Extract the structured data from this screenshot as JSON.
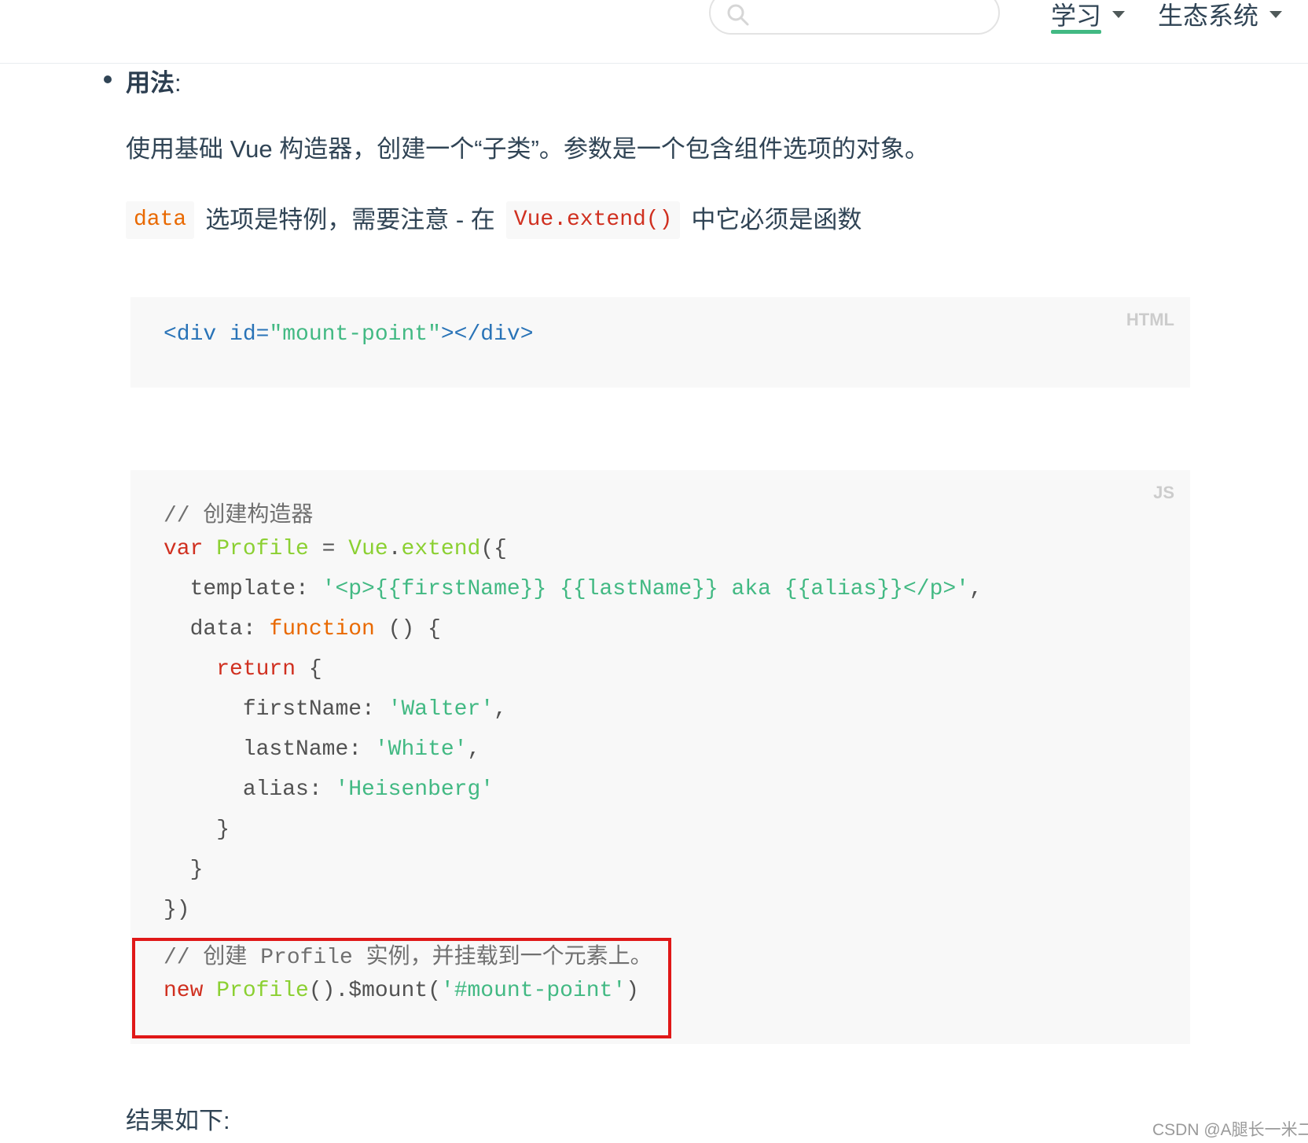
{
  "header": {
    "search_placeholder": "",
    "nav": [
      {
        "label": "学习"
      },
      {
        "label": "生态系统"
      }
    ]
  },
  "content": {
    "usage_label": "用法",
    "usage_colon": ":",
    "para1": "使用基础 Vue 构造器，创建一个“子类”。参数是一个包含组件选项的对象。",
    "para2": {
      "code1": "data",
      "text1": "选项是特例，需要注意 - 在",
      "code2": "Vue.extend()",
      "text2": "中它必须是函数"
    },
    "html_block": {
      "lang": "HTML",
      "line": {
        "open": "<div ",
        "attr": "id=",
        "value": "\"mount-point\"",
        "close": "></div>"
      }
    },
    "js_block": {
      "lang": "JS",
      "l1_comment": "// 创建构造器",
      "l2_var": "var",
      "l2_name": "Profile",
      "l2_eq": " = ",
      "l2_vue": "Vue",
      "l2_dot": ".",
      "l2_extend": "extend",
      "l2_tail": "({",
      "l3_key": "template: ",
      "l3_val": "'<p>{{firstName}} {{lastName}} aka {{alias}}</p>'",
      "l3_tail": ",",
      "l4_key": "data: ",
      "l4_fn": "function",
      "l4_tail": " () {",
      "l5_kw": "return",
      "l5_tail": " {",
      "l6_key": "firstName: ",
      "l6_val": "'Walter'",
      "l6_tail": ",",
      "l7_key": "lastName: ",
      "l7_val": "'White'",
      "l7_tail": ",",
      "l8_key": "alias: ",
      "l8_val": "'Heisenberg'",
      "l9": "}",
      "l10": "}",
      "l11": "})",
      "l12_comment": "// 创建 Profile 实例，并挂载到一个元素上。",
      "l13_new": "new",
      "l13_name": "Profile",
      "l13_mid": "().$mount(",
      "l13_arg": "'#mount-point'",
      "l13_tail": ")"
    },
    "result_label": "结果如下:"
  },
  "watermark": "CSDN @A腿长一米二",
  "colors": {
    "accent": "#42b983",
    "highlight_border": "#e01818",
    "code_bg": "#f8f8f8"
  }
}
